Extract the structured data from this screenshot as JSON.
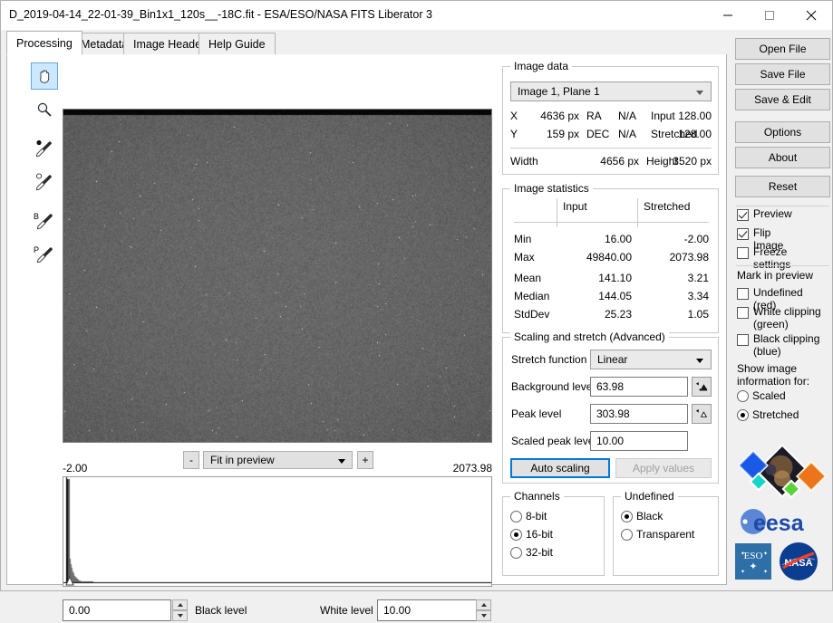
{
  "window": {
    "title": "D_2019-04-14_22-01-39_Bin1x1_120s__-18C.fit - ESA/ESO/NASA FITS Liberator 3",
    "minimize_label": "minimize-icon",
    "maximize_label": "maximize-icon",
    "close_label": "close-icon"
  },
  "tabs": [
    {
      "label": "Processing",
      "active": true
    },
    {
      "label": "Metadata",
      "active": false
    },
    {
      "label": "Image Headers",
      "active": false
    },
    {
      "label": "Help Guide",
      "active": false
    }
  ],
  "toolbar": {
    "items": [
      {
        "name": "hand-tool",
        "icon": "hand-icon",
        "selected": true
      },
      {
        "name": "zoom-tool",
        "icon": "magnifier-icon",
        "selected": false
      },
      {
        "name": "black-point-picker-tool",
        "icon": "eyedropper-black-icon",
        "selected": false
      },
      {
        "name": "white-point-picker-tool",
        "icon": "eyedropper-white-icon",
        "selected": false
      },
      {
        "name": "background-picker-tool",
        "icon": "eyedropper-b-icon",
        "label": "B",
        "selected": false
      },
      {
        "name": "peak-picker-tool",
        "icon": "eyedropper-p-icon",
        "label": "P",
        "selected": false
      }
    ]
  },
  "zoom_bar": {
    "minus_label": "-",
    "plus_label": "+",
    "level": "Fit in preview"
  },
  "histogram": {
    "min_label": "-2.00",
    "max_label": "2073.98"
  },
  "levels": {
    "black_value": "0.00",
    "black_label": "Black level",
    "white_label": "White level",
    "white_value": "10.00"
  },
  "image_data": {
    "legend": "Image data",
    "plane": "Image 1, Plane 1",
    "x_key": "X",
    "x_value": "4636 px",
    "ra_key": "RA",
    "ra_value": "N/A",
    "input_key": "Input",
    "input_value": "128.00",
    "y_key": "Y",
    "y_value": "159 px",
    "dec_key": "DEC",
    "dec_value": "N/A",
    "stretched_key": "Stretched",
    "stretched_value": "128.00",
    "width_key": "Width",
    "width_value": "4656 px",
    "height_key": "Height",
    "height_value": "3520 px"
  },
  "image_statistics": {
    "legend": "Image statistics",
    "columns": [
      "",
      "Input",
      "Stretched"
    ],
    "rows": [
      {
        "label": "Min",
        "input": "16.00",
        "stretched": "-2.00"
      },
      {
        "label": "Max",
        "input": "49840.00",
        "stretched": "2073.98"
      },
      {
        "label": "Mean",
        "input": "141.10",
        "stretched": "3.21"
      },
      {
        "label": "Median",
        "input": "144.05",
        "stretched": "3.34"
      },
      {
        "label": "StdDev",
        "input": "25.23",
        "stretched": "1.05"
      }
    ]
  },
  "scaling": {
    "legend": "Scaling and stretch (Advanced)",
    "stretch_function_label": "Stretch function",
    "stretch_function_value": "Linear",
    "background_level_label": "Background level",
    "background_level_value": "63.98",
    "peak_level_label": "Peak level",
    "peak_level_value": "303.98",
    "scaled_peak_level_label": "Scaled peak level",
    "scaled_peak_level_value": "10.00",
    "auto_scaling_label": "Auto scaling",
    "apply_values_label": "Apply values",
    "background_picker_icon": "picker-filled-icon",
    "peak_picker_icon": "picker-outline-icon"
  },
  "channels": {
    "legend": "Channels",
    "options": [
      {
        "label": "8-bit",
        "selected": false
      },
      {
        "label": "16-bit",
        "selected": true
      },
      {
        "label": "32-bit",
        "selected": false
      }
    ]
  },
  "undefined_group": {
    "legend": "Undefined",
    "options": [
      {
        "label": "Black",
        "selected": true
      },
      {
        "label": "Transparent",
        "selected": false
      }
    ]
  },
  "right_panel": {
    "buttons": [
      {
        "label": "Open File"
      },
      {
        "label": "Save File"
      },
      {
        "label": "Save & Edit"
      },
      {
        "label": "Options"
      },
      {
        "label": "About"
      },
      {
        "label": "Reset"
      }
    ],
    "checkboxes": [
      {
        "label": "Preview",
        "checked": true
      },
      {
        "label": "Flip Image",
        "checked": true
      },
      {
        "label": "Freeze settings",
        "checked": false
      }
    ],
    "mark_in_preview_title": "Mark in preview",
    "mark_checkboxes": [
      {
        "label": "Undefined (red)",
        "checked": false
      },
      {
        "label": "White clipping (green)",
        "checked": false
      },
      {
        "label": "Black clipping (blue)",
        "checked": false
      }
    ],
    "show_info_title": "Show image information for:",
    "show_info_options": [
      {
        "label": "Scaled",
        "selected": false
      },
      {
        "label": "Stretched",
        "selected": true
      }
    ],
    "logos": [
      "fits-liberator-logo",
      "esa-logo",
      "eso-logo",
      "nasa-logo"
    ]
  },
  "colors": {
    "accent": "#0078d7",
    "tab_selected_bg": "#ffffff",
    "panel_bg": "#f0f0f0",
    "button_bg": "#e1e1e1"
  }
}
